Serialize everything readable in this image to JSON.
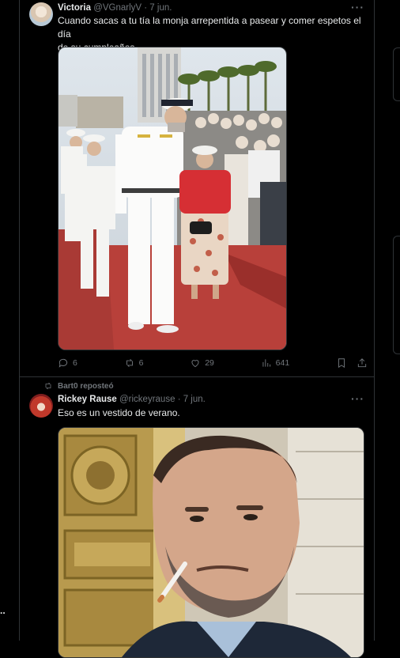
{
  "left_ellipsis": "..",
  "tweets": [
    {
      "name": "Victoria",
      "handle": "@VGnarlyV",
      "date": "· 7 jun.",
      "more": "···",
      "text_line1": "Cuando sacas a tu tía la monja arrepentida a pasear y comer espetos el día",
      "text_line2": "de su cumpleaños.",
      "actions": {
        "replies": "6",
        "reposts": "6",
        "likes": "29",
        "views": "641"
      },
      "icons": [
        "reply-icon",
        "repost-icon",
        "like-icon",
        "views-icon",
        "bookmark-icon",
        "share-icon"
      ]
    },
    {
      "reposted_by": "Bart0 reposteó",
      "name": "Rickey Rause",
      "handle": "@rickeyrause",
      "date": "· 7 jun.",
      "more": "···",
      "text": "Eso es un vestido de verano."
    }
  ],
  "colors": {
    "background": "#000000",
    "border": "#2f3336",
    "text_primary": "#e7e9ea",
    "text_secondary": "#71767b"
  }
}
